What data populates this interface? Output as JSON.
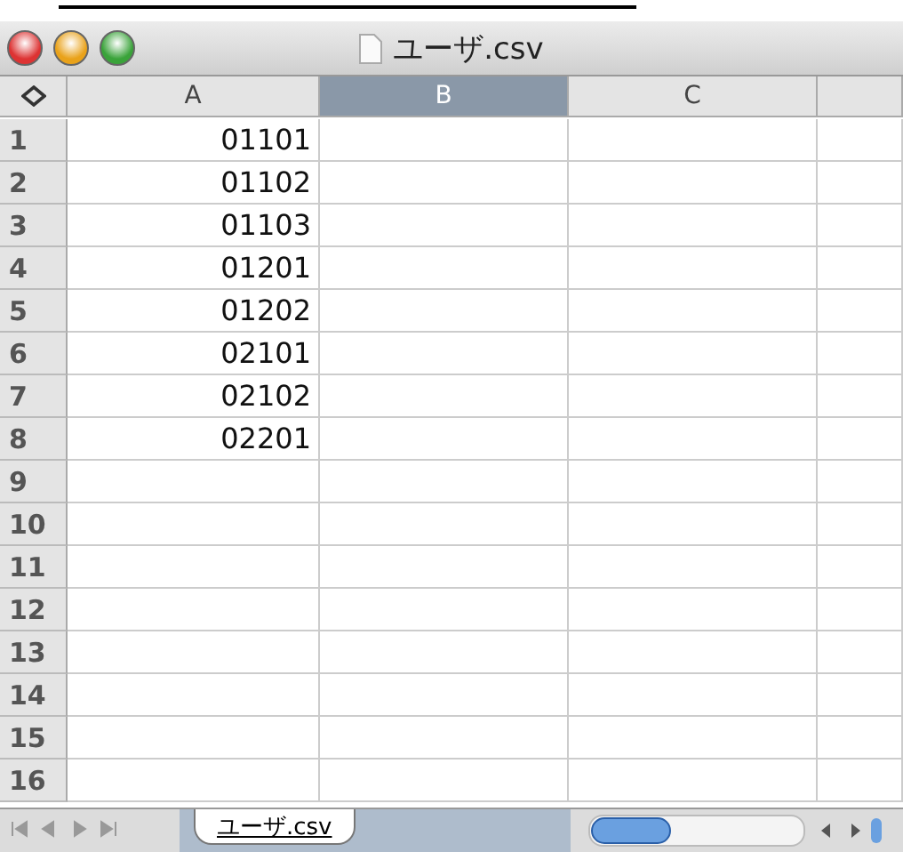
{
  "window": {
    "title": "ユーザ.csv"
  },
  "columns": [
    {
      "label": "A",
      "selected": false
    },
    {
      "label": "B",
      "selected": true
    },
    {
      "label": "C",
      "selected": false
    }
  ],
  "rows": [
    {
      "number": "1",
      "cells": [
        "01101"
      ]
    },
    {
      "number": "2",
      "cells": [
        "01102"
      ]
    },
    {
      "number": "3",
      "cells": [
        "01103"
      ]
    },
    {
      "number": "4",
      "cells": [
        "01201"
      ]
    },
    {
      "number": "5",
      "cells": [
        "01202"
      ]
    },
    {
      "number": "6",
      "cells": [
        "02101"
      ]
    },
    {
      "number": "7",
      "cells": [
        "02102"
      ]
    },
    {
      "number": "8",
      "cells": [
        "02201"
      ]
    },
    {
      "number": "9",
      "cells": []
    },
    {
      "number": "10",
      "cells": []
    },
    {
      "number": "11",
      "cells": []
    },
    {
      "number": "12",
      "cells": []
    },
    {
      "number": "13",
      "cells": []
    },
    {
      "number": "14",
      "cells": []
    },
    {
      "number": "15",
      "cells": []
    },
    {
      "number": "16",
      "cells": []
    }
  ],
  "sheet_tabs": [
    {
      "label": "ユーザ.csv",
      "selected": true
    }
  ]
}
